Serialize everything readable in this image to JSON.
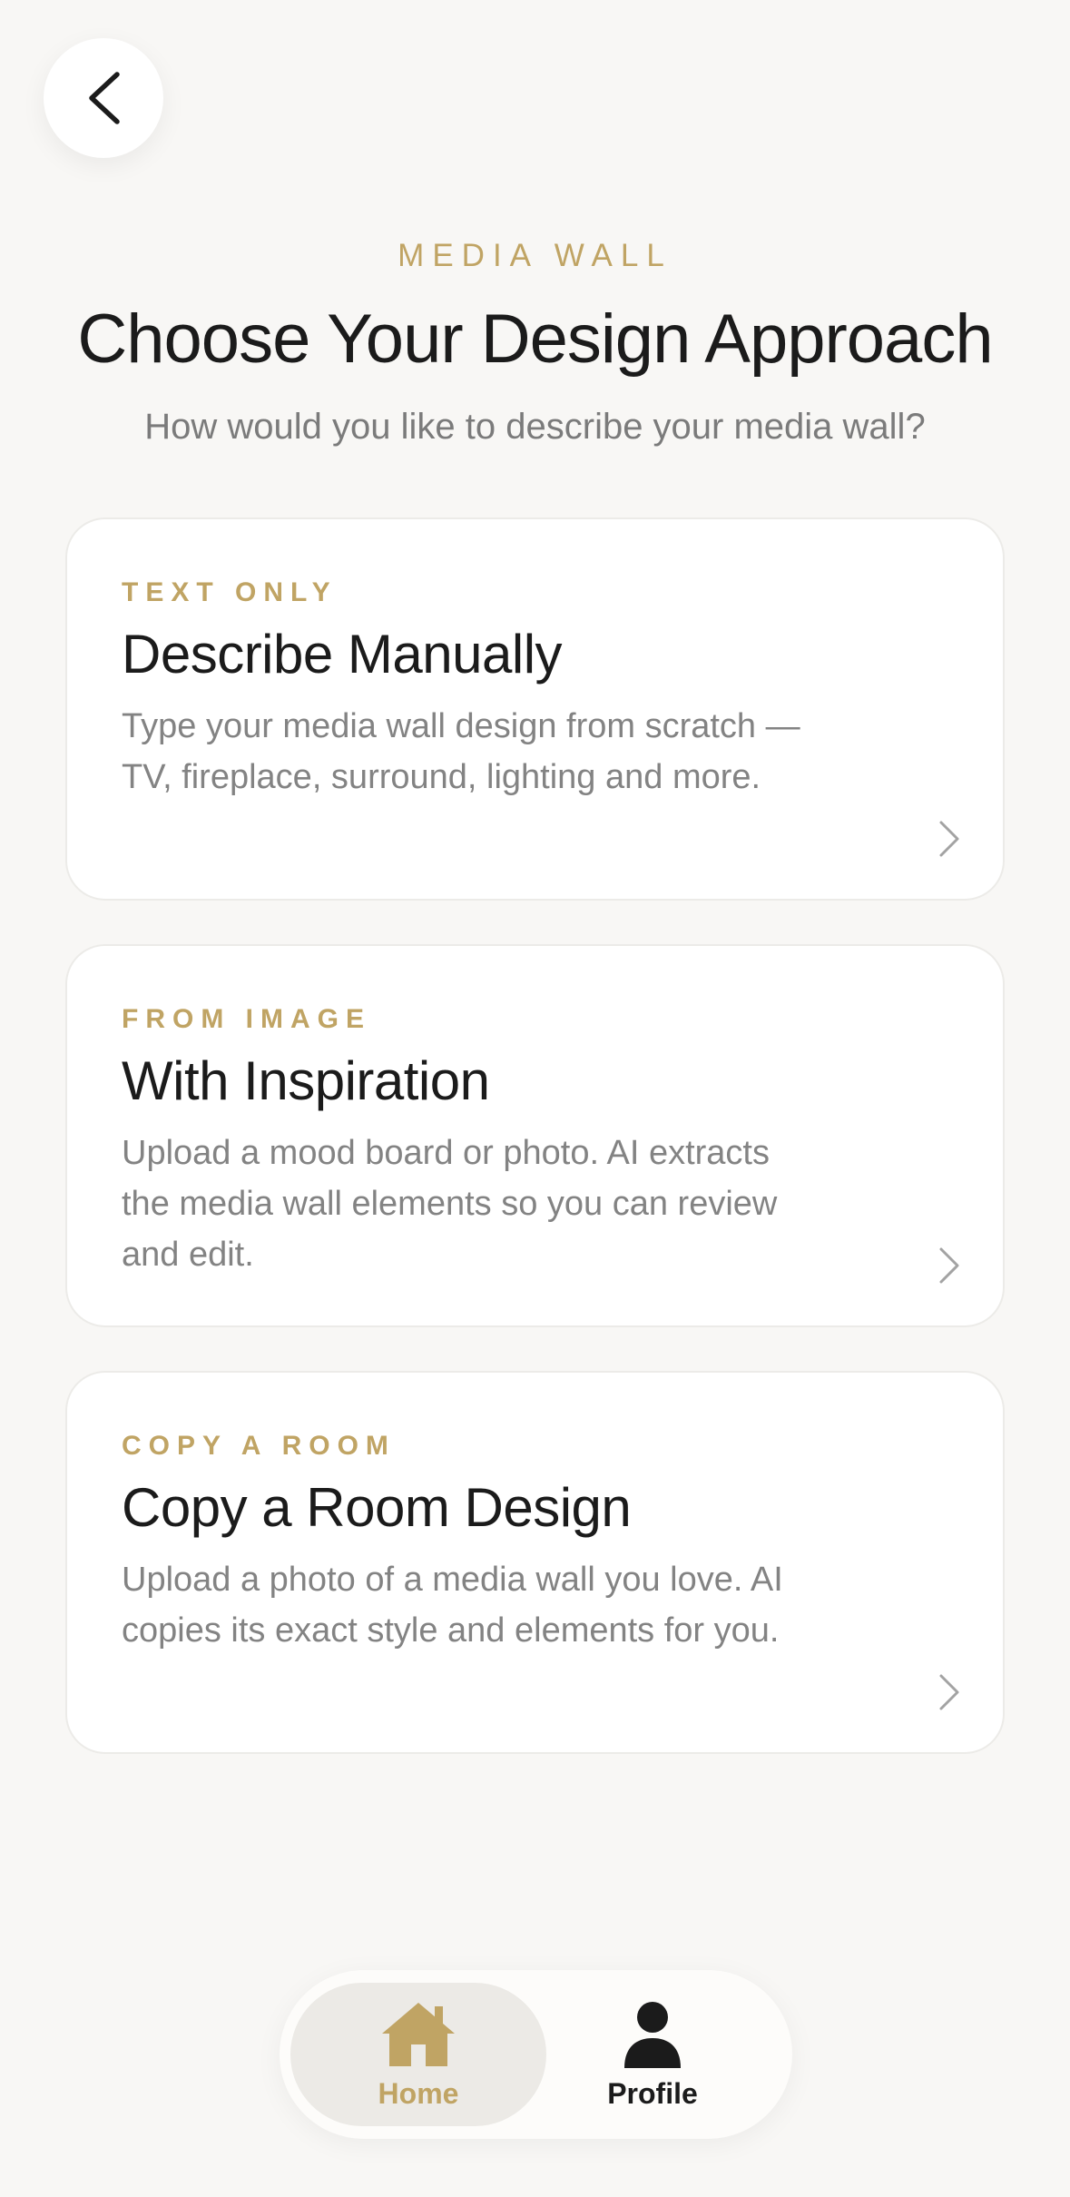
{
  "header": {
    "eyebrow": "MEDIA WALL",
    "title": "Choose Your Design Approach",
    "subtitle": "How would you like to describe your media wall?"
  },
  "cards": [
    {
      "tag": "TEXT ONLY",
      "title": "Describe Manually",
      "description": "Type your media wall design from scratch — TV, fireplace, surround, lighting and more."
    },
    {
      "tag": "FROM IMAGE",
      "title": "With Inspiration",
      "description": "Upload a mood board or photo. AI extracts the media wall elements so you can review and edit."
    },
    {
      "tag": "COPY A ROOM",
      "title": "Copy a Room Design",
      "description": "Upload a photo of a media wall you love. AI copies its exact style and elements for you."
    }
  ],
  "tabbar": {
    "home_label": "Home",
    "profile_label": "Profile",
    "active": "home"
  },
  "icons": {
    "back": "chevron-left-icon",
    "card_arrow": "chevron-right-icon",
    "home": "home-icon",
    "profile": "person-icon"
  },
  "colors": {
    "accent": "#c0a464",
    "background": "#f8f7f5",
    "card": "#ffffff",
    "text": "#1b1b1b",
    "muted": "#838383"
  }
}
